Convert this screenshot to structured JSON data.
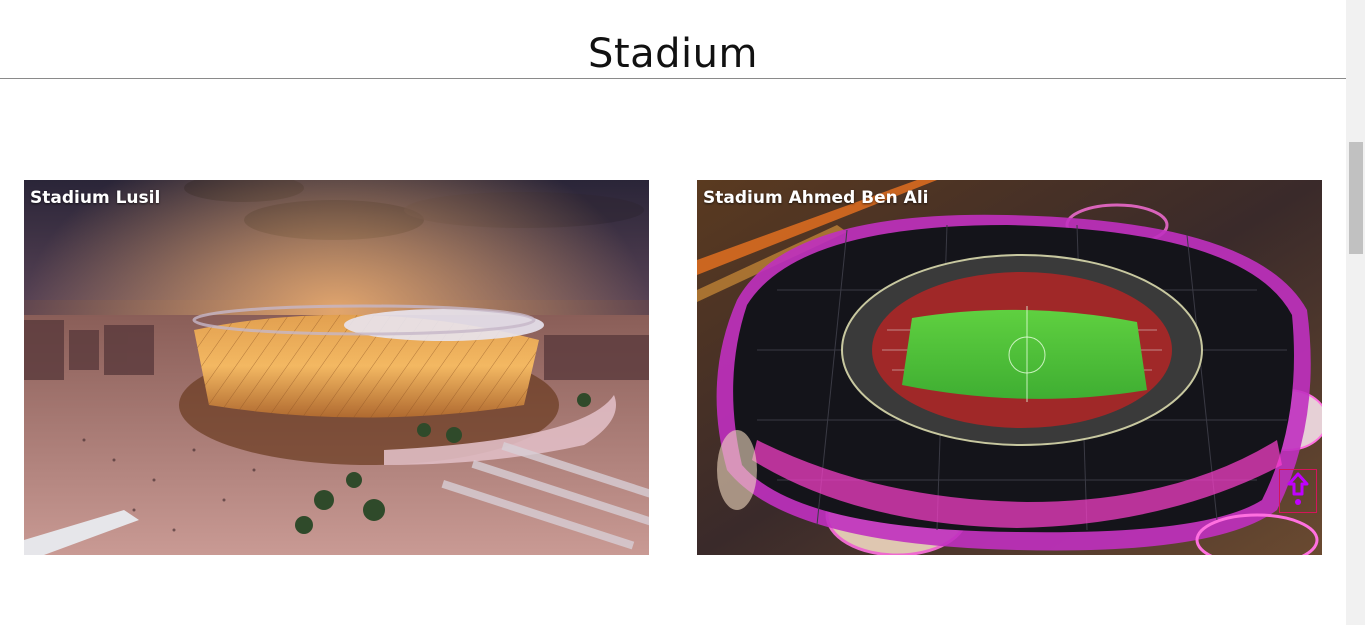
{
  "page": {
    "title": "Stadium"
  },
  "stadiums": [
    {
      "name": "Stadium Lusil",
      "image": "lusail-stadium-night"
    },
    {
      "name": "Stadium Ahmed Ben Ali",
      "image": "ahmad-bin-ali-stadium-aerial"
    }
  ],
  "scroll_top": {
    "icon": "arrow-up-icon",
    "color": "#c000ff",
    "border_color": "#d4145a"
  }
}
